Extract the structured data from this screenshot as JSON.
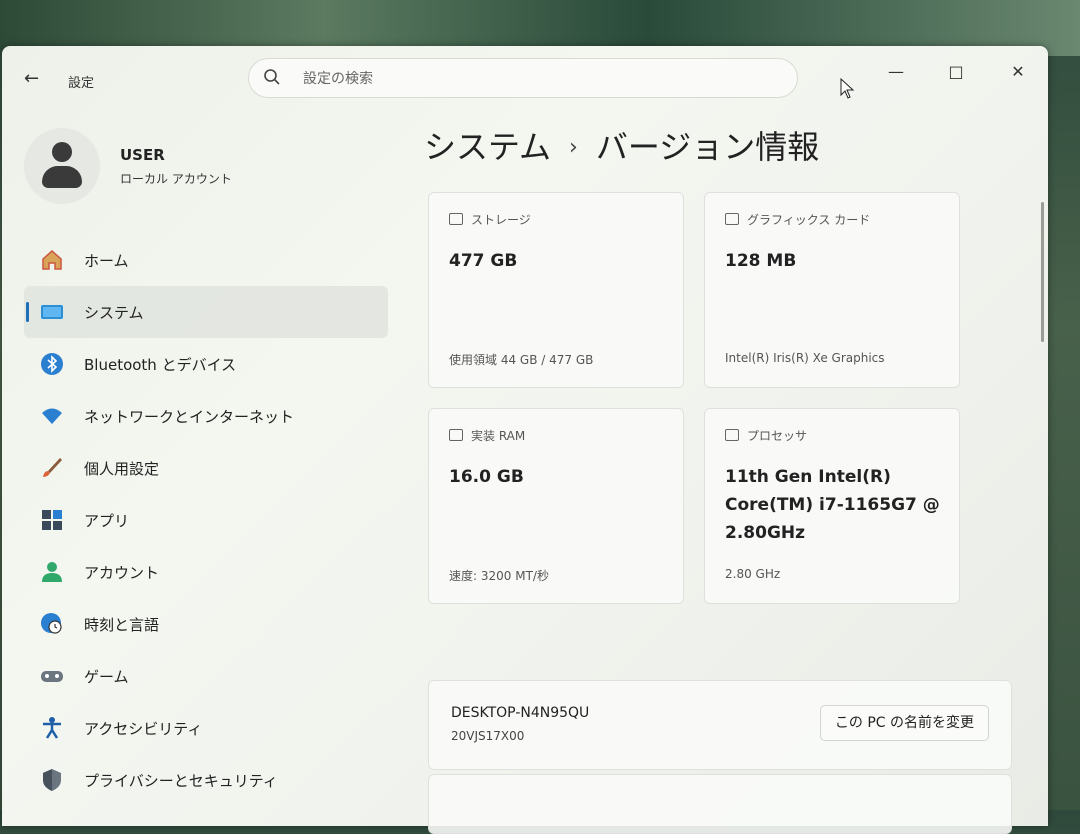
{
  "window": {
    "app_title": "設定"
  },
  "search": {
    "placeholder": "設定の検索"
  },
  "user": {
    "name": "USER",
    "account_type": "ローカル アカウント"
  },
  "sidebar": {
    "items": [
      {
        "label": "ホーム",
        "icon": "home-icon"
      },
      {
        "label": "システム",
        "icon": "system-icon"
      },
      {
        "label": "Bluetooth とデバイス",
        "icon": "bluetooth-icon"
      },
      {
        "label": "ネットワークとインターネット",
        "icon": "network-icon"
      },
      {
        "label": "個人用設定",
        "icon": "brush-icon"
      },
      {
        "label": "アプリ",
        "icon": "apps-icon"
      },
      {
        "label": "アカウント",
        "icon": "account-icon"
      },
      {
        "label": "時刻と言語",
        "icon": "time-language-icon"
      },
      {
        "label": "ゲーム",
        "icon": "gamepad-icon"
      },
      {
        "label": "アクセシビリティ",
        "icon": "accessibility-icon"
      },
      {
        "label": "プライバシーとセキュリティ",
        "icon": "shield-icon"
      }
    ],
    "active": "システム"
  },
  "breadcrumb": {
    "parent": "システム",
    "separator": "›",
    "current": "バージョン情報"
  },
  "specs": {
    "storage": {
      "header": "ストレージ",
      "value": "477 GB",
      "sub": "使用領域 44 GB / 477 GB"
    },
    "graphics": {
      "header": "グラフィックス カード",
      "value": "128 MB",
      "sub": "Intel(R) Iris(R) Xe Graphics"
    },
    "ram": {
      "header": "実装 RAM",
      "value": "16.0 GB",
      "sub": "速度: 3200 MT/秒"
    },
    "processor": {
      "header": "プロセッサ",
      "value": "11th Gen Intel(R) Core(TM) i7-1165G7 @ 2.80GHz",
      "sub": "2.80 GHz"
    }
  },
  "device": {
    "name": "DESKTOP-N4N95QU",
    "model": "20VJS17X00",
    "rename_label": "この PC の名前を変更"
  },
  "colors": {
    "accent": "#1f6fb8"
  }
}
